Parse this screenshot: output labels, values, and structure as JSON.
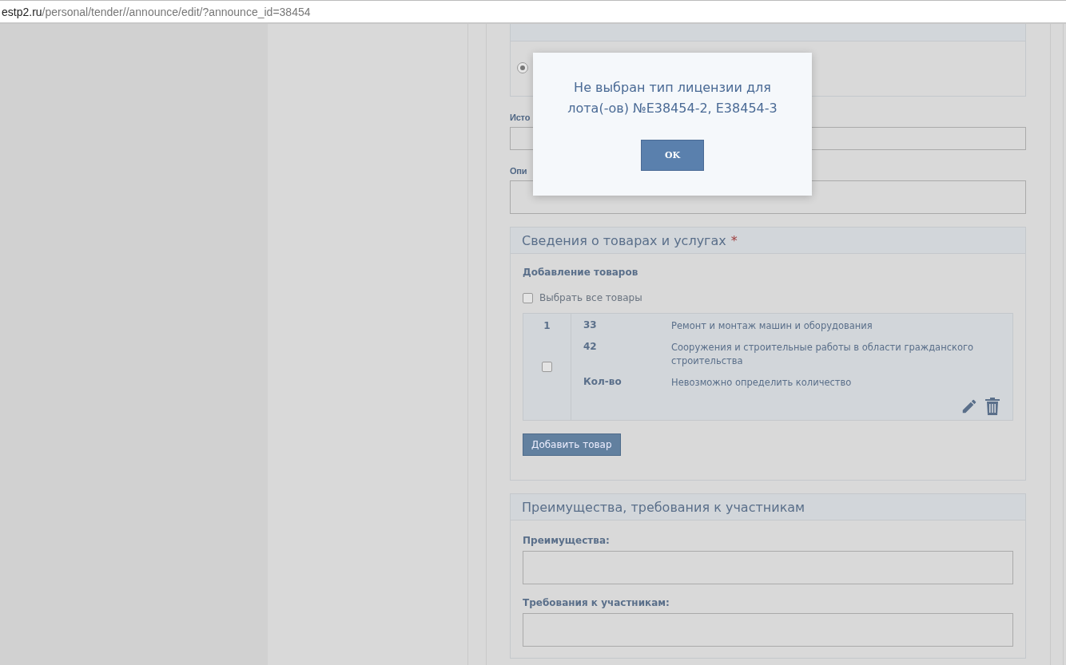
{
  "address_bar": {
    "domain": "estp2.ru",
    "path": "/personal/tender//announce/edit/?announce_id=38454"
  },
  "top_panel": {
    "radio": {
      "selected": true
    }
  },
  "fields": [
    {
      "label": "Исто",
      "kind": "input"
    },
    {
      "label": "Опи",
      "kind": "textarea"
    }
  ],
  "goods_panel": {
    "title": "Сведения о товарах и услугах",
    "required_mark": "*",
    "subtitle": "Добавление товаров",
    "select_all": {
      "label": "Выбрать все товары",
      "checked": false
    },
    "items": [
      {
        "number": "1",
        "checked": false,
        "rows": [
          {
            "key": "33",
            "value": "Ремонт и монтаж машин и оборудования"
          },
          {
            "key": "42",
            "value": "Сооружения и строительные работы в области гражданского строительства"
          },
          {
            "key": "Кол-во",
            "value": "Невозможно определить количество"
          }
        ]
      }
    ],
    "add_button": "Добавить товар"
  },
  "advantages_panel": {
    "title": "Преимущества, требования к участникам",
    "fields": [
      {
        "label": "Преимущества:"
      },
      {
        "label": "Требования к участникам:"
      }
    ]
  },
  "dialog": {
    "message": "Не выбран тип лицензии для лота(-ов) №E38454-2, E38454-3",
    "button": "OK"
  }
}
